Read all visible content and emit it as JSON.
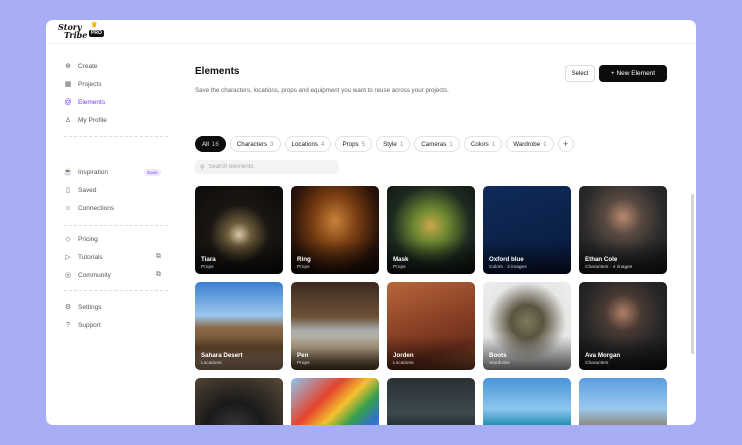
{
  "brand": {
    "logo_line1": "Story",
    "logo_line2": "Tribe",
    "badge": "PRO"
  },
  "sidebar": {
    "group1": [
      {
        "label": "Create",
        "icon": "plus-circle-icon"
      },
      {
        "label": "Projects",
        "icon": "grid-icon"
      },
      {
        "label": "Elements",
        "icon": "at-icon",
        "active": true
      },
      {
        "label": "My Profile",
        "icon": "user-icon"
      }
    ],
    "group2": [
      {
        "label": "Inspiration",
        "icon": "coffee-icon",
        "badge": "Soon"
      },
      {
        "label": "Saved",
        "icon": "bookmark-icon"
      },
      {
        "label": "Connections",
        "icon": "users-icon"
      }
    ],
    "group3": [
      {
        "label": "Pricing",
        "icon": "tag-icon"
      },
      {
        "label": "Tutorials",
        "icon": "play-icon",
        "external": true
      },
      {
        "label": "Community",
        "icon": "discord-icon",
        "external": true
      }
    ],
    "group4": [
      {
        "label": "Settings",
        "icon": "gear-icon"
      },
      {
        "label": "Support",
        "icon": "help-icon"
      }
    ]
  },
  "main": {
    "title": "Elements",
    "subtitle": "Save the characters, locations, props and equipment you want to reuse across your projects.",
    "select_label": "Select",
    "new_label": "+ New Element",
    "search_placeholder": "Search elements",
    "filters": [
      {
        "label": "All",
        "count": "16",
        "active": true
      },
      {
        "label": "Characters",
        "count": "3"
      },
      {
        "label": "Locations",
        "count": "4"
      },
      {
        "label": "Props",
        "count": "5"
      },
      {
        "label": "Style",
        "count": "1"
      },
      {
        "label": "Cameras",
        "count": "1"
      },
      {
        "label": "Colors",
        "count": "1"
      },
      {
        "label": "Wardrobe",
        "count": "1"
      }
    ],
    "cards": [
      {
        "name": "Tiara",
        "meta": "Props",
        "bg": "tiara"
      },
      {
        "name": "Ring",
        "meta": "Props",
        "bg": "ring"
      },
      {
        "name": "Mask",
        "meta": "Props",
        "bg": "mask"
      },
      {
        "name": "Oxford blue",
        "meta": "Colors · 3 images",
        "bg": "oxford"
      },
      {
        "name": "Ethan Cole",
        "meta": "Characters · 4 images",
        "bg": "ethan"
      },
      {
        "name": "Sahara Desert",
        "meta": "Locations",
        "bg": "sahara"
      },
      {
        "name": "Pen",
        "meta": "Props",
        "bg": "pen"
      },
      {
        "name": "Jorden",
        "meta": "Locations",
        "bg": "jorden"
      },
      {
        "name": "Boots",
        "meta": "Wardrobe",
        "bg": "boots"
      },
      {
        "name": "Ava Morgan",
        "meta": "Characters",
        "bg": "ava"
      },
      {
        "name": "",
        "meta": "",
        "bg": "camera"
      },
      {
        "name": "",
        "meta": "",
        "bg": "kite"
      },
      {
        "name": "",
        "meta": "",
        "bg": "night"
      },
      {
        "name": "",
        "meta": "",
        "bg": "beach"
      },
      {
        "name": "",
        "meta": "",
        "bg": "castle"
      }
    ]
  },
  "colors": {
    "accent": "#6b3cf6",
    "page_bg": "#a7aef6",
    "button_dark": "#0d0d0d"
  }
}
